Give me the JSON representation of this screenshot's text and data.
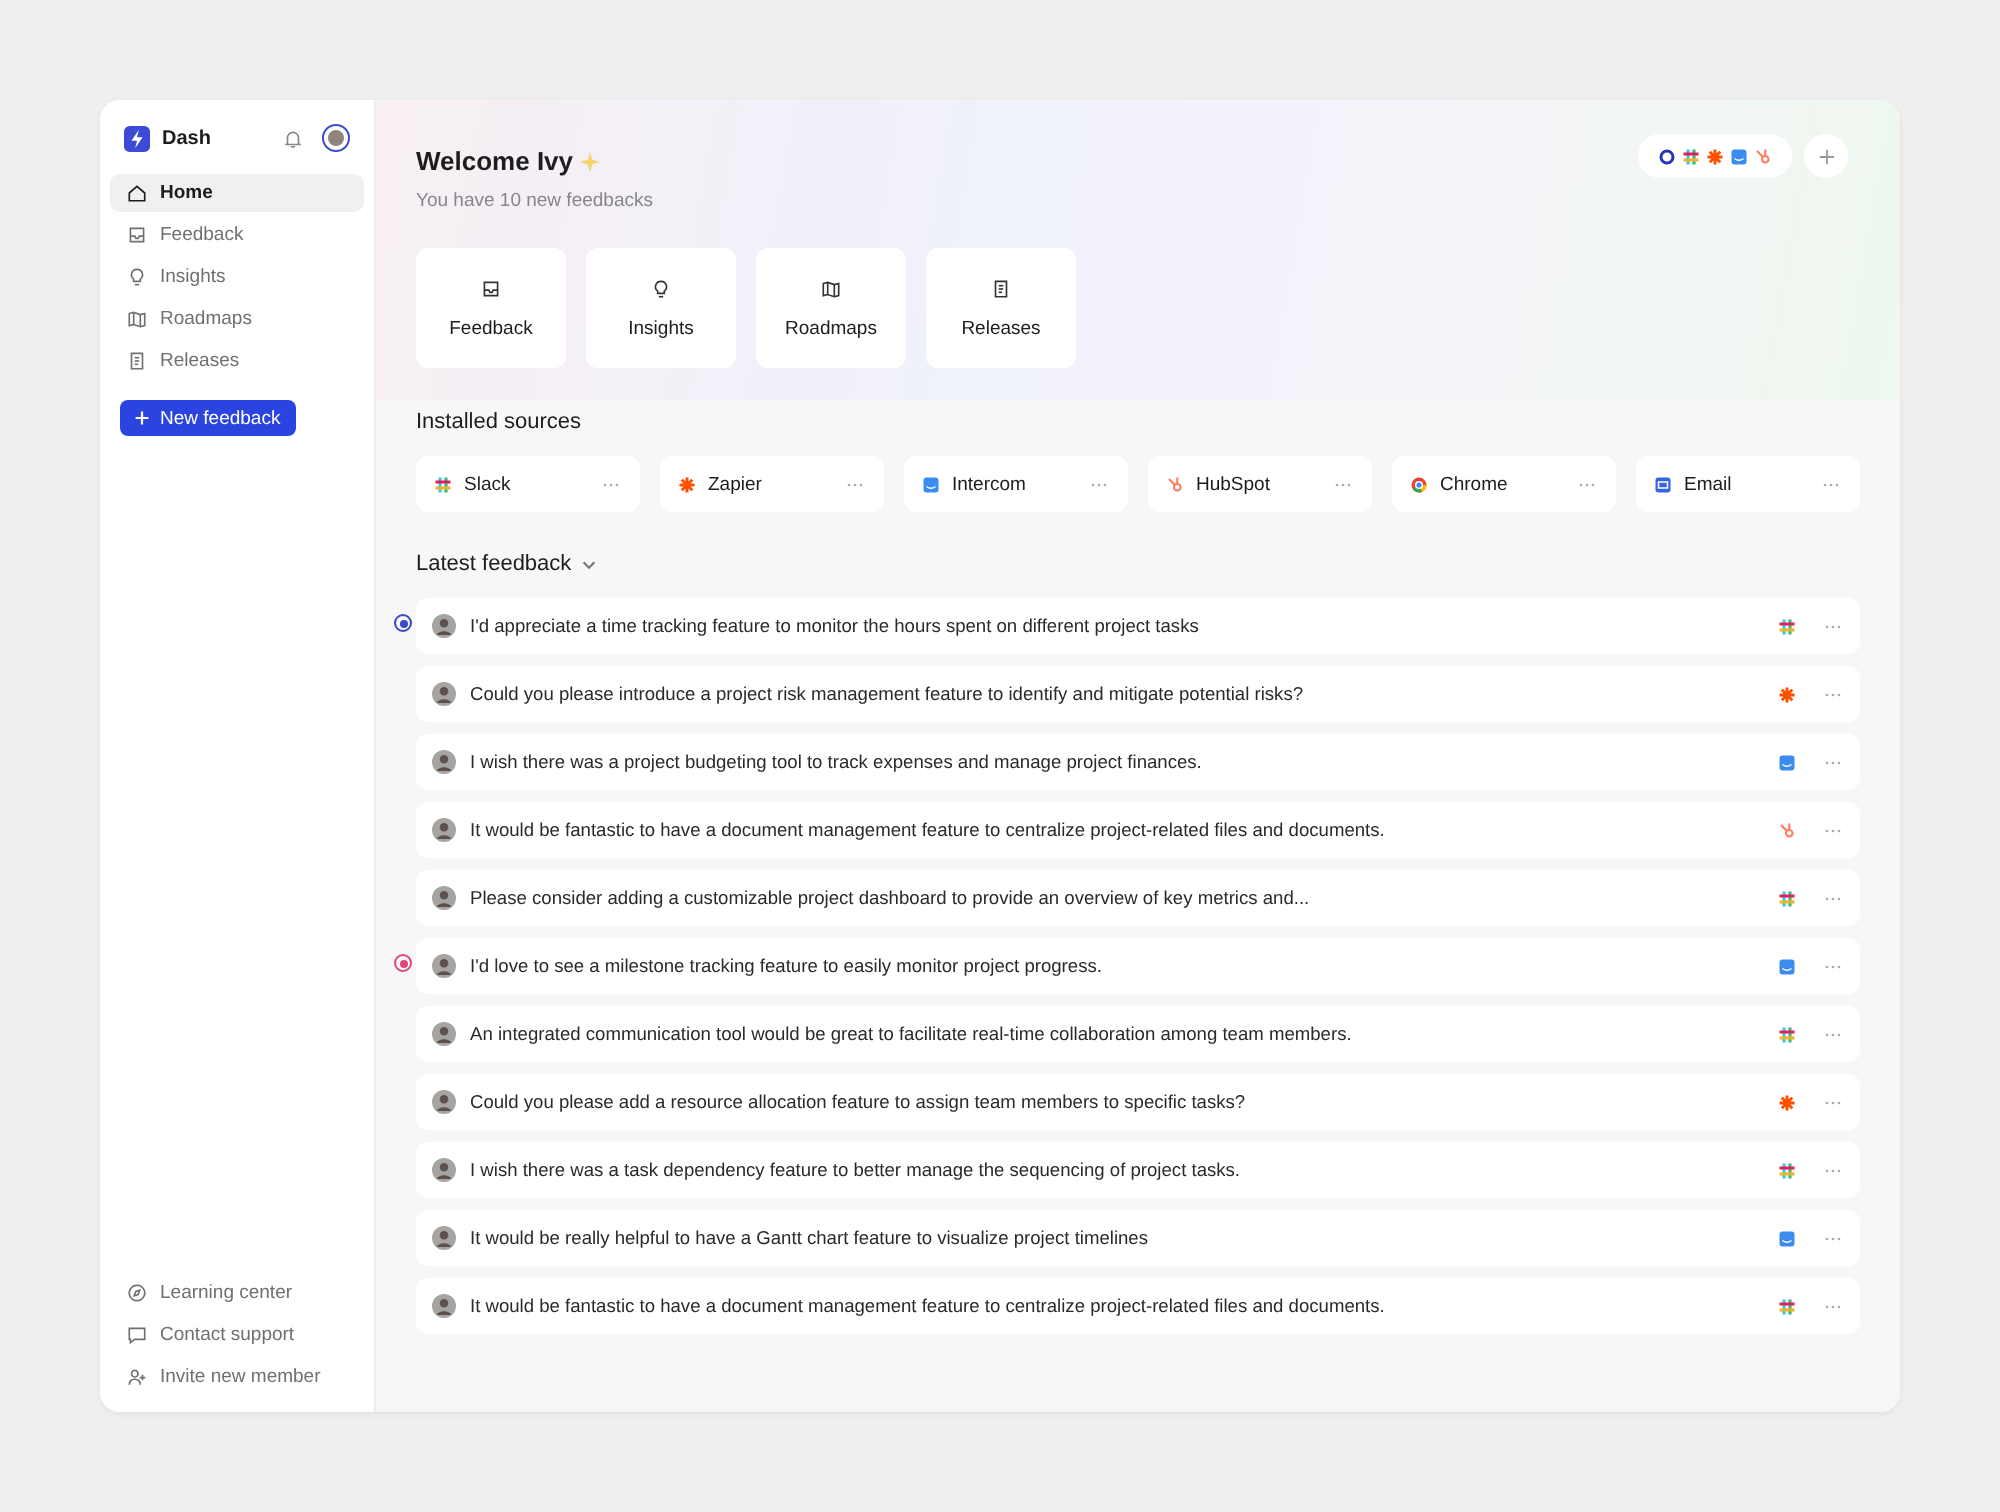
{
  "workspace": {
    "name": "Dash"
  },
  "nav": [
    {
      "label": "Home",
      "selected": true
    },
    {
      "label": "Feedback",
      "selected": false
    },
    {
      "label": "Insights",
      "selected": false
    },
    {
      "label": "Roadmaps",
      "selected": false
    },
    {
      "label": "Releases",
      "selected": false
    }
  ],
  "new_button": "New feedback",
  "footer_links": [
    {
      "label": "Learning center"
    },
    {
      "label": "Contact support"
    },
    {
      "label": "Invite new member"
    }
  ],
  "welcome": {
    "title": "Welcome Ivy",
    "subtitle": "You have 10 new feedbacks"
  },
  "quick_links": [
    {
      "label": "Feedback"
    },
    {
      "label": "Insights"
    },
    {
      "label": "Roadmaps"
    },
    {
      "label": "Releases"
    }
  ],
  "sources_heading": "Installed sources",
  "sources": [
    {
      "name": "Slack",
      "kind": "slack"
    },
    {
      "name": "Zapier",
      "kind": "zapier"
    },
    {
      "name": "Intercom",
      "kind": "intercom"
    },
    {
      "name": "HubSpot",
      "kind": "hubspot"
    },
    {
      "name": "Chrome",
      "kind": "chrome"
    },
    {
      "name": "Email",
      "kind": "email"
    }
  ],
  "feedback_heading": "Latest feedback",
  "feedback": [
    {
      "text": "I'd appreciate a time tracking feature to monitor the hours spent on different project tasks",
      "kind": "slack",
      "marker": {
        "color": "#3949c8"
      }
    },
    {
      "text": "Could you please introduce a project risk management feature to identify and mitigate potential risks?",
      "kind": "zapier"
    },
    {
      "text": "I wish there was a project budgeting tool to track expenses and manage project finances.",
      "kind": "intercom"
    },
    {
      "text": "It would be fantastic to have a document management feature to centralize project-related files and documents.",
      "kind": "hubspot"
    },
    {
      "text": "Please consider adding a customizable project dashboard to provide an overview of key metrics and...",
      "kind": "slack"
    },
    {
      "text": "I'd love to see a milestone tracking feature to easily monitor project progress.",
      "kind": "intercom",
      "marker": {
        "color": "#e0457b"
      }
    },
    {
      "text": "An integrated communication tool would be great to facilitate real-time collaboration among team members.",
      "kind": "slack"
    },
    {
      "text": "Could you please add a resource allocation feature to assign team members to specific tasks?",
      "kind": "zapier"
    },
    {
      "text": "I wish there was a task dependency feature to better manage the sequencing of project tasks.",
      "kind": "slack"
    },
    {
      "text": "It would be really helpful to have a Gantt chart feature to visualize project timelines",
      "kind": "intercom"
    },
    {
      "text": "It would be fantastic to have a document management feature to centralize project-related files and documents.",
      "kind": "slack"
    }
  ]
}
